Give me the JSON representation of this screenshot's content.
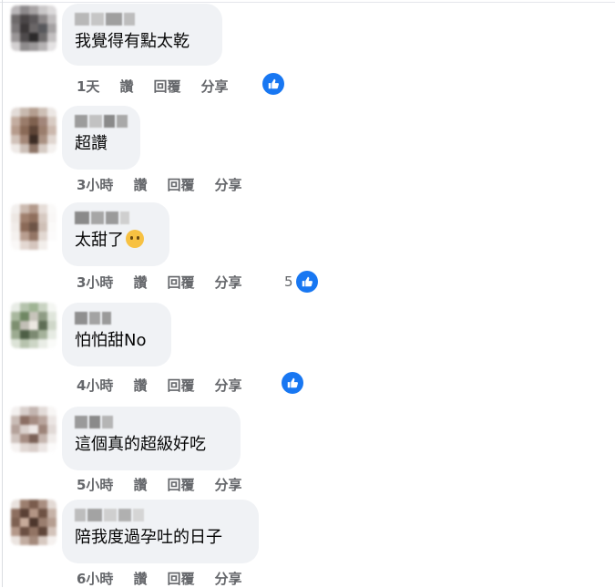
{
  "actions": {
    "like": "讚",
    "reply": "回覆",
    "share": "分享"
  },
  "colors": {
    "like_blue": "#1877f2",
    "bubble": "#f0f2f5",
    "muted": "#65676b"
  },
  "comments": [
    {
      "text": "我覺得有點太乾",
      "time": "1天",
      "has_like_icon": true,
      "like_count": ""
    },
    {
      "text": "超讚",
      "time": "3小時",
      "has_like_icon": false,
      "like_count": ""
    },
    {
      "text": "太甜了",
      "time": "3小時",
      "has_like_icon": true,
      "like_count": "5",
      "emoji": "crying-face-icon"
    },
    {
      "text": "怕怕甜No",
      "time": "4小時",
      "has_like_icon": true,
      "like_count": ""
    },
    {
      "text": "這個真的超級好吃",
      "time": "5小時",
      "has_like_icon": false,
      "like_count": ""
    },
    {
      "text": "陪我度過孕吐的日子",
      "time": "6小時",
      "has_like_icon": false,
      "like_count": ""
    }
  ]
}
